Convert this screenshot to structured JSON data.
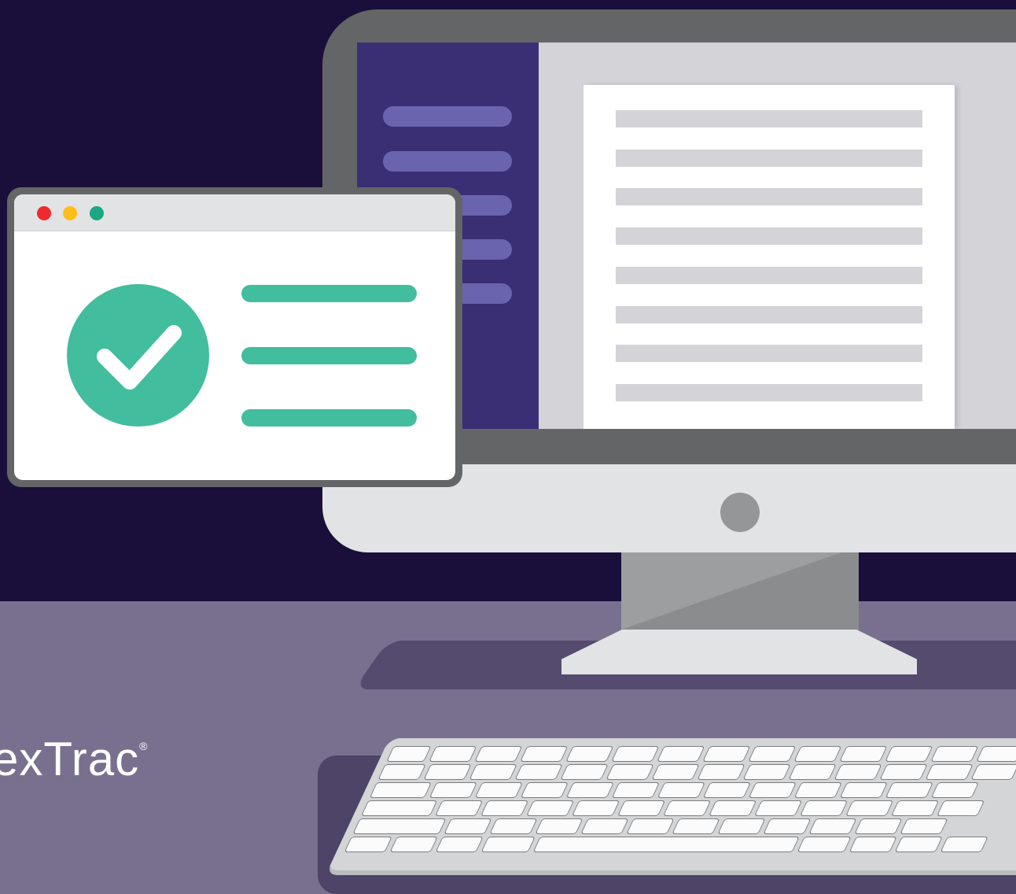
{
  "logo": {
    "text": "exTrac",
    "mark": "®"
  },
  "popup": {
    "window_buttons": [
      "close-dot",
      "minimize-dot",
      "maximize-dot"
    ],
    "status_icon": "check-icon",
    "colors": {
      "close": "#ee2a2f",
      "minimize": "#ffbd18",
      "maximize": "#1aa883",
      "accent": "#42bd9e"
    }
  },
  "colors": {
    "background": "#190f3a",
    "floor": "#79708f",
    "sidebar": "#3a2f75",
    "sidebar_items": "#6a63ae",
    "monitor_frame": "#646566"
  }
}
